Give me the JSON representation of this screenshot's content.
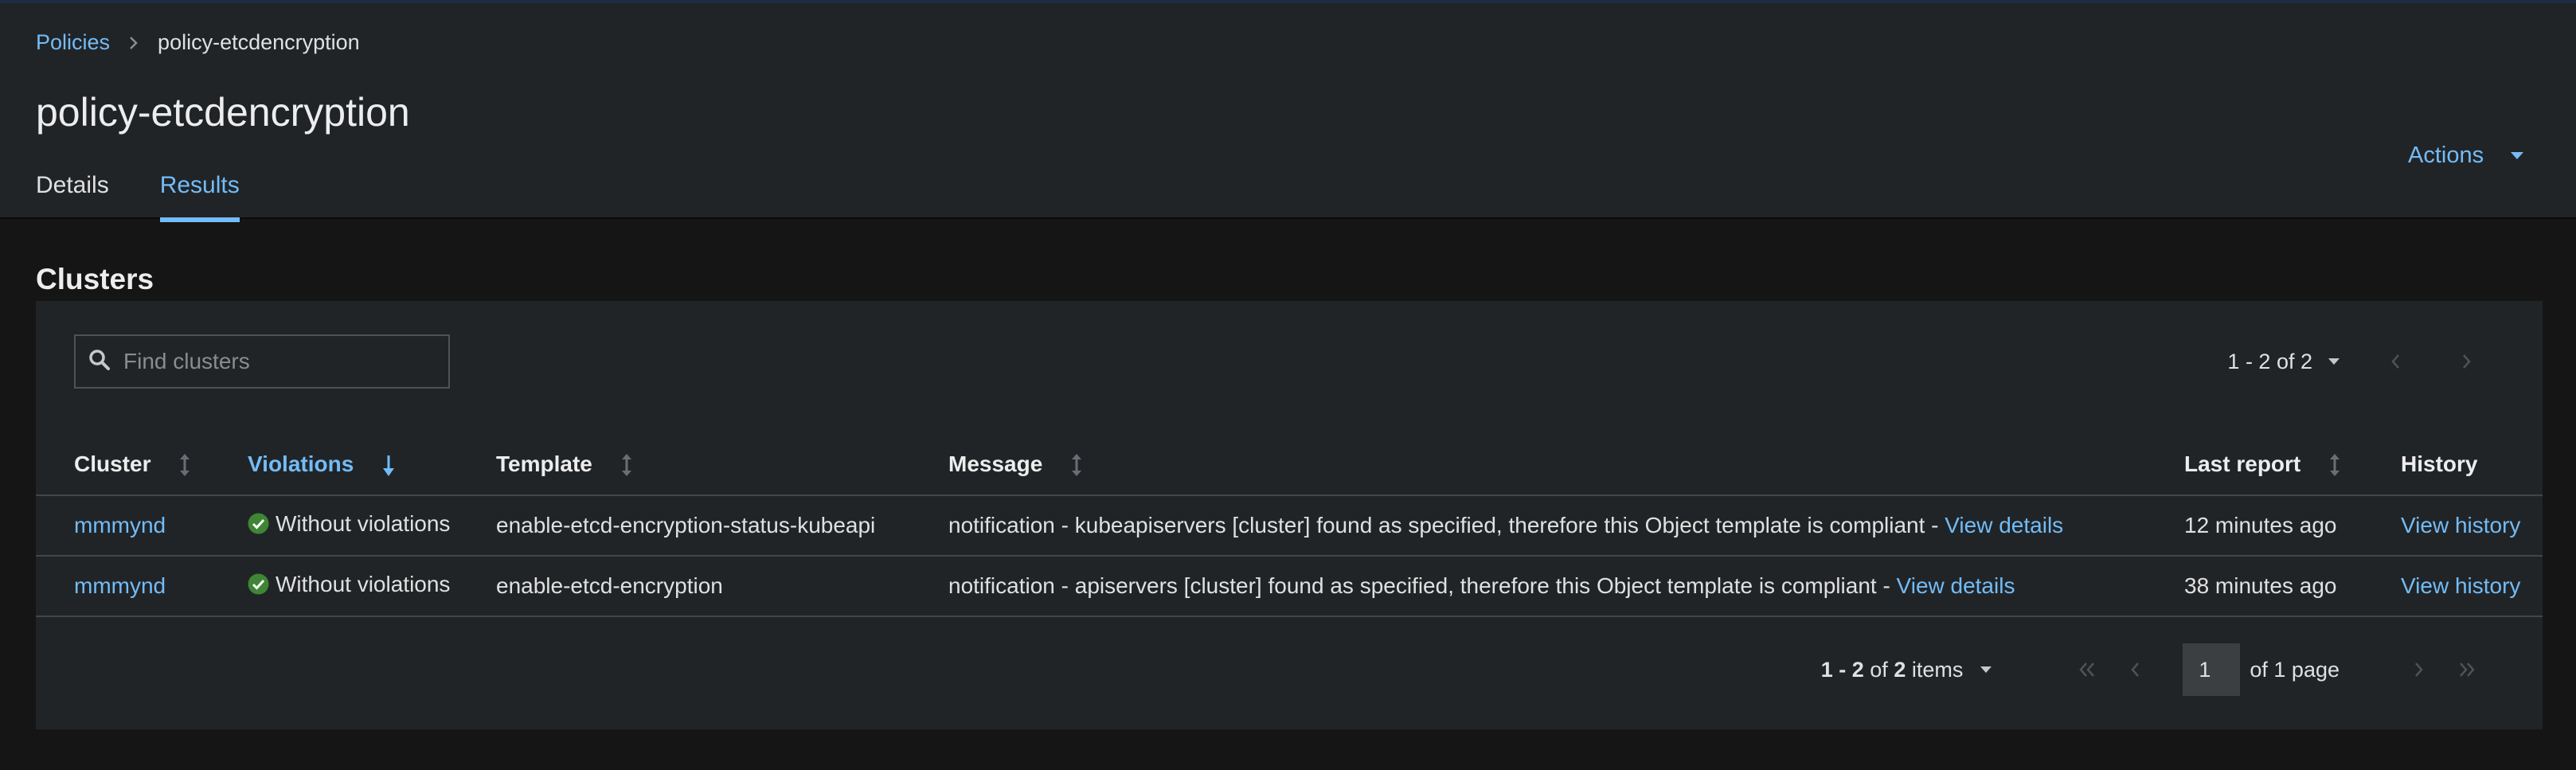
{
  "breadcrumb": {
    "parent": "Policies",
    "current": "policy-etcdencryption"
  },
  "page": {
    "title": "policy-etcdencryption"
  },
  "tabs": [
    {
      "label": "Details",
      "active": false
    },
    {
      "label": "Results",
      "active": true
    }
  ],
  "actions": {
    "label": "Actions"
  },
  "section": {
    "title": "Clusters"
  },
  "search": {
    "placeholder": "Find clusters",
    "value": ""
  },
  "pagination_top": {
    "range": "1 - 2 of 2"
  },
  "table": {
    "columns": [
      "Cluster",
      "Violations",
      "Template",
      "Message",
      "Last report",
      "History"
    ],
    "sorted_column": "Violations",
    "rows": [
      {
        "cluster": "mmmynd",
        "violations": "Without violations",
        "template": "enable-etcd-encryption-status-kubeapi",
        "message": "notification - kubeapiservers [cluster] found as specified, therefore this Object template is compliant - ",
        "message_link": "View details",
        "last_report": "12 minutes ago",
        "history": "View history"
      },
      {
        "cluster": "mmmynd",
        "violations": "Without violations",
        "template": "enable-etcd-encryption",
        "message": "notification - apiservers [cluster] found as specified, therefore this Object template is compliant - ",
        "message_link": "View details",
        "last_report": "38 minutes ago",
        "history": "View history"
      }
    ]
  },
  "pagination_bottom": {
    "range": "1 - 2",
    "of_label": "of",
    "total": "2",
    "items_label": "items",
    "page": "1",
    "of_pages": "of 1 page"
  },
  "colors": {
    "accent": "#73bcf7",
    "success": "#3e8635",
    "background": "#151515",
    "surface": "#212427"
  },
  "icons": [
    "chevron-right-icon",
    "caret-down-icon",
    "search-icon",
    "sort-icon",
    "sort-down-icon",
    "check-circle-icon",
    "angle-left-icon",
    "angle-right-icon",
    "angle-double-left-icon",
    "angle-double-right-icon"
  ]
}
